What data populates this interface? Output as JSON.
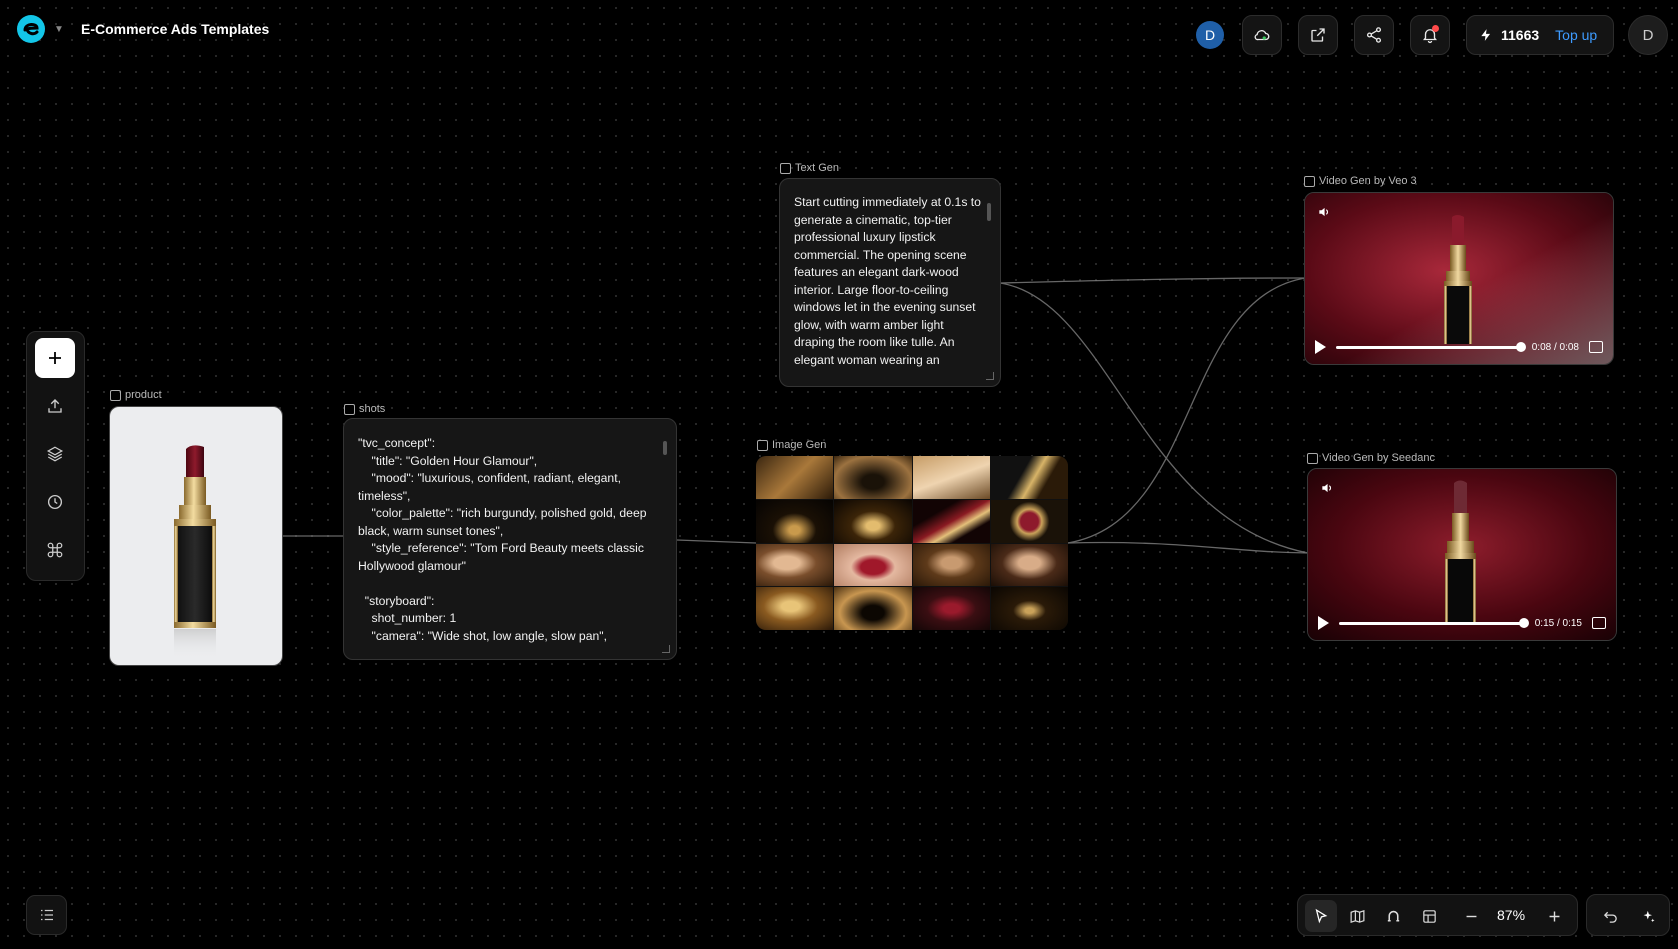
{
  "app": {
    "title": "E-Commerce Ads Templates"
  },
  "header": {
    "user_initial_small": "D",
    "credits": "11663",
    "top_up_label": "Top up",
    "user_initial": "D"
  },
  "nodes": {
    "product": {
      "label": "product"
    },
    "shots": {
      "label": "shots",
      "text": "\"tvc_concept\":\n    \"title\": \"Golden Hour Glamour\",\n    \"mood\": \"luxurious, confident, radiant, elegant,\ntimeless\",\n    \"color_palette\": \"rich burgundy, polished gold, deep\nblack, warm sunset tones\",\n    \"style_reference\": \"Tom Ford Beauty meets classic\nHollywood glamour\"\n\n  \"storyboard\":\n    shot_number: 1\n    \"camera\": \"Wide shot, low angle, slow pan\","
    },
    "text_gen": {
      "label": "Text Gen",
      "text": "Start cutting immediately at 0.1s to\ngenerate a cinematic, top-tier\nprofessional luxury lipstick\ncommercial. The opening scene\nfeatures an elegant dark-wood\ninterior. Large floor-to-ceiling\nwindows let in the evening sunset\nglow, with warm amber light\ndraping the room like tulle. An\nelegant woman wearing an"
    },
    "image_gen": {
      "label": "Image Gen"
    },
    "video_veo": {
      "label": "Video Gen by Veo 3",
      "time": "0:08 / 0:08",
      "progress": 1.0
    },
    "video_seedance": {
      "label": "Video Gen by Seedanc",
      "time": "0:15 / 0:15",
      "progress": 1.0
    }
  },
  "zoom": {
    "level": "87%"
  },
  "colors": {
    "accent": "#3e9bff",
    "canvas": "#000000",
    "burgundy": "#6e0f1c",
    "gold": "#c9a25a"
  },
  "icons": {
    "left_toolbar": [
      "plus-icon",
      "upload-icon",
      "layers-icon",
      "history-icon",
      "command-icon"
    ],
    "header": [
      "cloud-icon",
      "external-link-icon",
      "share-icon",
      "bell-icon",
      "lightning-icon"
    ],
    "bottom": [
      "outline-icon",
      "pointer-icon",
      "map-icon",
      "magnet-icon",
      "layout-icon",
      "zoom-out-icon",
      "zoom-in-icon",
      "undo-icon",
      "sparkle-icon"
    ]
  }
}
